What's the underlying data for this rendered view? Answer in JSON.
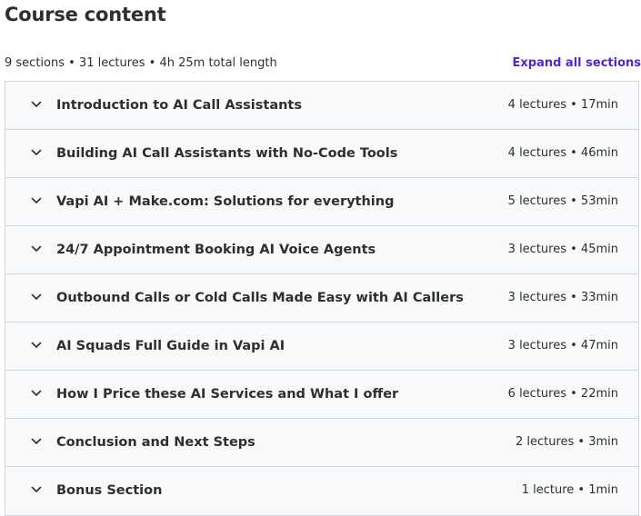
{
  "title": "Course content",
  "summary": "9 sections • 31 lectures • 4h 25m total length",
  "expand_label": "Expand all sections",
  "colors": {
    "accent": "#5624d0",
    "text": "#2d2f31",
    "row_bg": "#f7f9fa",
    "border": "#d1d7dc"
  },
  "sections": [
    {
      "title": "Introduction to AI Call Assistants",
      "meta": "4 lectures • 17min",
      "icon": "chevron-down-icon"
    },
    {
      "title": "Building AI Call Assistants with No-Code Tools",
      "meta": "4 lectures • 46min",
      "icon": "chevron-down-icon"
    },
    {
      "title": "Vapi AI + Make.com: Solutions for everything",
      "meta": "5 lectures • 53min",
      "icon": "chevron-down-icon"
    },
    {
      "title": "24/7 Appointment Booking AI Voice Agents",
      "meta": "3 lectures • 45min",
      "icon": "chevron-down-icon"
    },
    {
      "title": "Outbound Calls or Cold Calls Made Easy with AI Callers",
      "meta": "3 lectures • 33min",
      "icon": "chevron-down-icon"
    },
    {
      "title": "AI Squads Full Guide in Vapi AI",
      "meta": "3 lectures • 47min",
      "icon": "chevron-down-icon"
    },
    {
      "title": "How I Price these AI Services and What I offer",
      "meta": "6 lectures • 22min",
      "icon": "chevron-down-icon"
    },
    {
      "title": "Conclusion and Next Steps",
      "meta": "2 lectures • 3min",
      "icon": "chevron-down-icon"
    },
    {
      "title": "Bonus Section",
      "meta": "1 lecture • 1min",
      "icon": "chevron-down-icon"
    }
  ]
}
